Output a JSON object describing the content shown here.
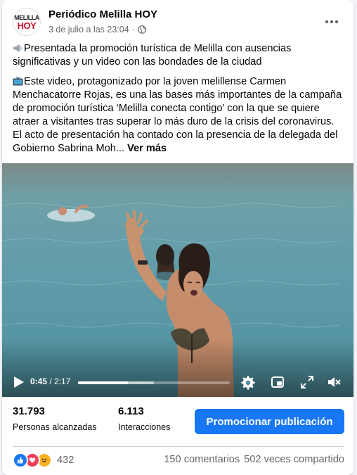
{
  "post": {
    "page_name": "Periódico Melilla HOY",
    "date": "3 de julio a las 23:04",
    "separator": "·",
    "logo_line1": "MELILLA",
    "logo_line2": "HOY",
    "headline": "Presentada la promoción turística de Melilla con ausencias significativas y un video con las bondades de la ciudad",
    "body": "Este video, protagonizado por la joven melillense Carmen Menchacatorre Rojas, es una las bases más importantes de la campaña de promoción turística ‘Melilla conecta contigo’ con la que se quiere atraer a visitantes tras superar lo más duro de la crisis del coronavirus. El acto de presentación ha contado con la presencia de la  delegada del Gobierno Sabrina Moh...",
    "see_more": "Ver más",
    "more_icon": "more-dots-icon"
  },
  "video": {
    "current_time": "0:45",
    "duration": "/ 2:17",
    "progress": 0.33,
    "buffered": 0.5
  },
  "stats": {
    "reach_value": "31.793",
    "reach_label": "Personas alcanzadas",
    "interactions_value": "6.113",
    "interactions_label": "Interacciones",
    "promote_label": "Promocionar publicación"
  },
  "footer": {
    "reaction_count": "432",
    "comments": "150 comentarios",
    "shares": "502 veces compartido"
  },
  "colors": {
    "accent": "#1877f2",
    "like": "#1877f2",
    "love": "#f33e58",
    "haha": "#f7b125"
  }
}
